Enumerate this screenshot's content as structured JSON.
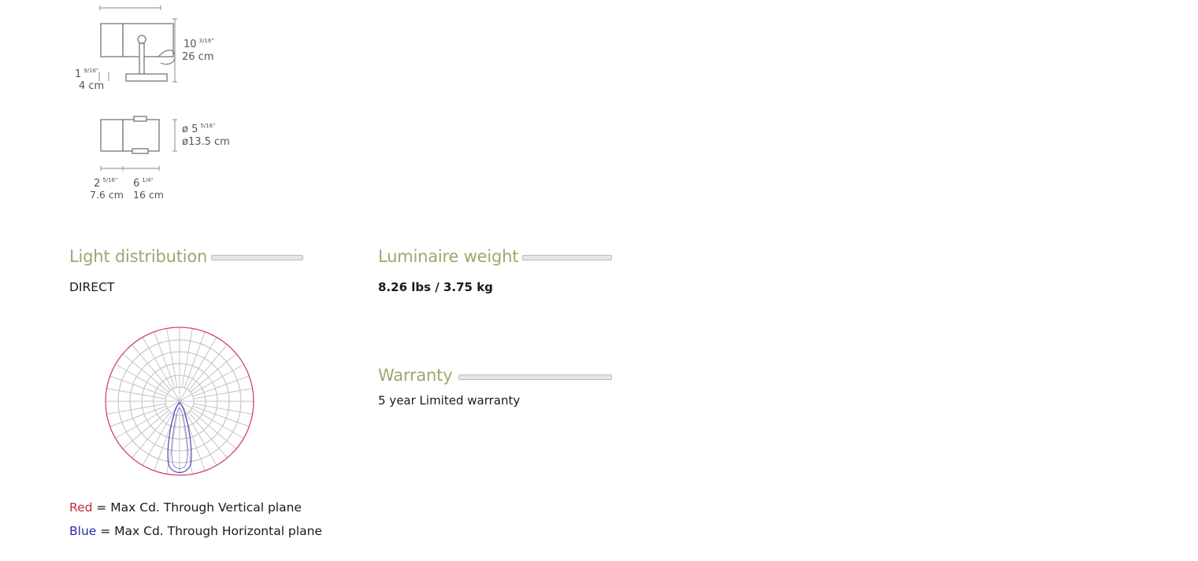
{
  "dimensions": {
    "height_in_whole": "10",
    "height_in_frac": "3/16\"",
    "height_cm": "26 cm",
    "depth_in_whole": "1",
    "depth_in_frac": "9/16\"",
    "depth_cm": "4 cm",
    "diameter_in_whole": "ø 5",
    "diameter_in_frac": "5/16\"",
    "diameter_cm": "ø13.5 cm",
    "width_a_in_whole": "2",
    "width_a_in_frac": "5/16\"",
    "width_a_cm": "7.6 cm",
    "width_b_in_whole": "6",
    "width_b_in_frac": "1/4\"",
    "width_b_cm": "16 cm"
  },
  "light_distribution": {
    "title": "Light distribution",
    "value": "DIRECT",
    "legend": {
      "red_word": "Red",
      "red_rest": " = Max Cd. Through Vertical plane",
      "blue_word": "Blue",
      "blue_rest": " = Max Cd. Through Horizontal plane"
    }
  },
  "luminaire_weight": {
    "title": "Luminaire weight",
    "value": "8.26 lbs / 3.75 kg"
  },
  "warranty": {
    "title": "Warranty",
    "value": "5 year Limited warranty"
  },
  "colors": {
    "title_green": "#9aa96e",
    "vertical_plane_red": "#c8283c",
    "horizontal_plane_blue": "#2a2aa8"
  }
}
